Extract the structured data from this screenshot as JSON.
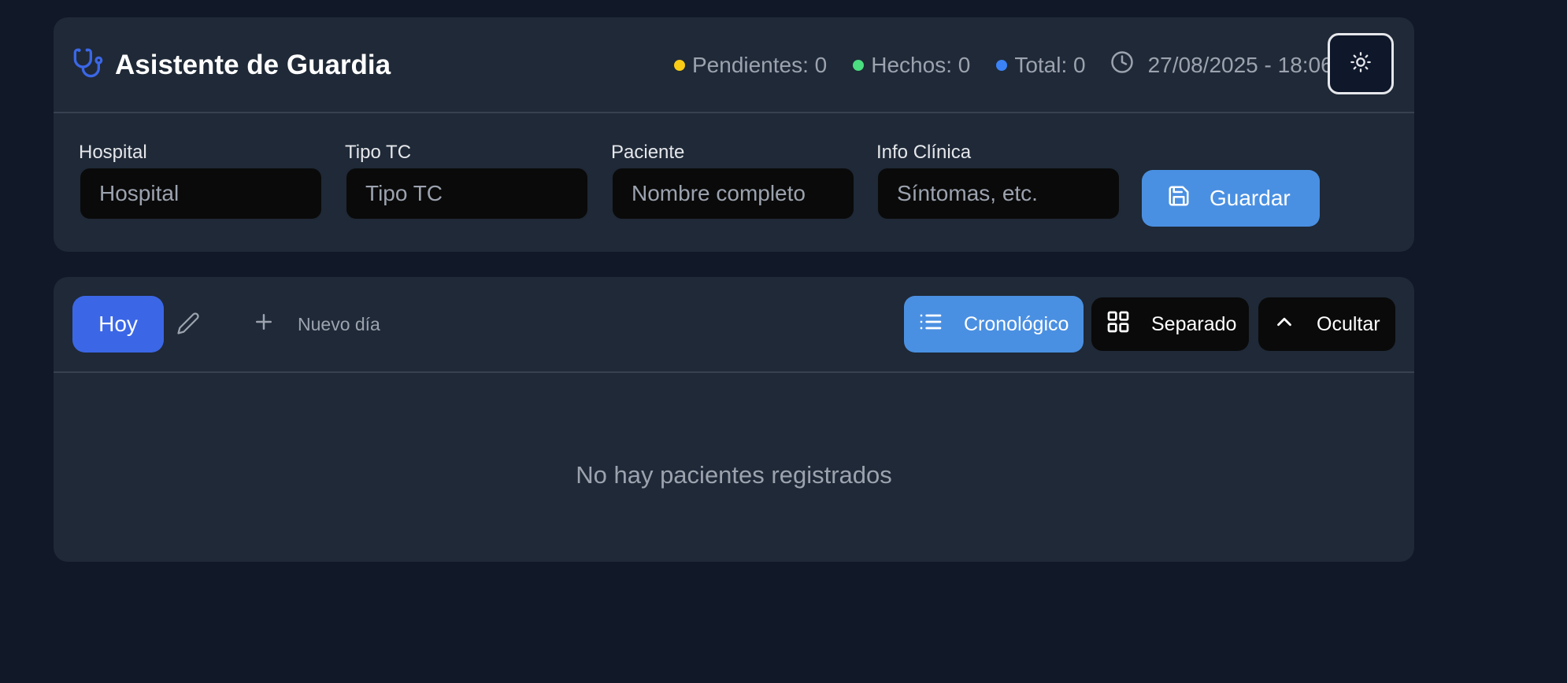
{
  "header": {
    "title": "Asistente de Guardia",
    "stats": {
      "pending": "Pendientes: 0",
      "done": "Hechos: 0",
      "total": "Total: 0"
    },
    "datetime": "27/08/2025 - 18:06"
  },
  "form": {
    "hospital": {
      "label": "Hospital",
      "placeholder": "Hospital"
    },
    "tipo_tc": {
      "label": "Tipo TC",
      "placeholder": "Tipo TC"
    },
    "paciente": {
      "label": "Paciente",
      "placeholder": "Nombre completo"
    },
    "info": {
      "label": "Info Clínica",
      "placeholder": "Síntomas, etc."
    },
    "save_label": "Guardar"
  },
  "toolbar": {
    "today_tab": "Hoy",
    "new_day": "Nuevo día",
    "views": {
      "chrono": "Cronológico",
      "separate": "Separado",
      "hide": "Ocultar"
    }
  },
  "list": {
    "empty_text": "No hay pacientes registrados"
  },
  "colors": {
    "background": "#111827",
    "card": "#1f2937",
    "accent": "#4a90e2",
    "today_tab": "#3b67e6",
    "pending_dot": "#facc15",
    "done_dot": "#4ade80",
    "total_dot": "#3b82f6"
  },
  "icons": {
    "brand": "stethoscope-icon",
    "clock": "clock-icon",
    "theme": "sun-icon",
    "save": "save-icon",
    "edit": "pencil-icon",
    "new_day": "plus-icon",
    "chrono": "list-icon",
    "separate": "grid-icon",
    "hide": "chevron-up-icon"
  }
}
